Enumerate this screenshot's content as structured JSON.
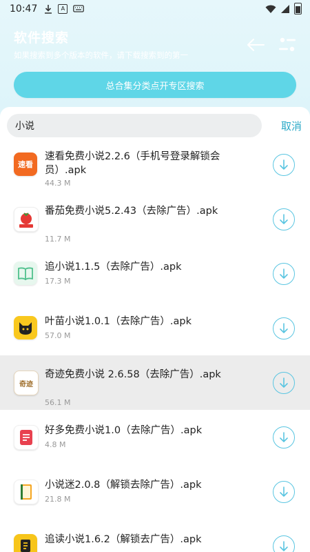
{
  "status_bar": {
    "time": "10:47"
  },
  "header": {
    "title": "软件搜索",
    "subtitle": "如果搜索到多个版本的软件，请下载搜索到的第一"
  },
  "promo_button": {
    "label": "总合集分类点开专区搜索"
  },
  "search": {
    "value": "小说",
    "cancel_label": "取消"
  },
  "apps": [
    {
      "name": "速看免费小说2.2.6（手机号登录解锁会员）.apk",
      "size": "44.3 M",
      "icon": "sukan-app-icon",
      "color": "#f26a21"
    },
    {
      "name": "番茄免费小说5.2.43（去除广告）.apk",
      "size": "11.7 M",
      "icon": "fanqie-app-icon",
      "color": "#e53935"
    },
    {
      "name": "追小说1.1.5（去除广告）.apk",
      "size": "17.3 M",
      "icon": "book-app-icon",
      "color": "#4fc08d"
    },
    {
      "name": "叶苗小说1.0.1（去除广告）.apk",
      "size": "57.0 M",
      "icon": "cat-app-icon",
      "color": "#f9c81e"
    },
    {
      "name": "奇迹免费小说 2.6.58（去除广告）.apk",
      "size": "56.1 M",
      "icon": "qiji-app-icon",
      "color": "#e0b878"
    },
    {
      "name": "好多免费小说1.0（去除广告）.apk",
      "size": "4.8 M",
      "icon": "haoduo-app-icon",
      "color": "#e8414f"
    },
    {
      "name": "小说迷2.0.8（解锁去除广告）.apk",
      "size": "21.8 M",
      "icon": "xiaoshuomi-app-icon",
      "color": "#f5a623"
    },
    {
      "name": "追读小说1.6.2（解锁去广告）.apk",
      "size": "",
      "icon": "zhuidu-app-icon",
      "color": "#f7c51a"
    }
  ]
}
